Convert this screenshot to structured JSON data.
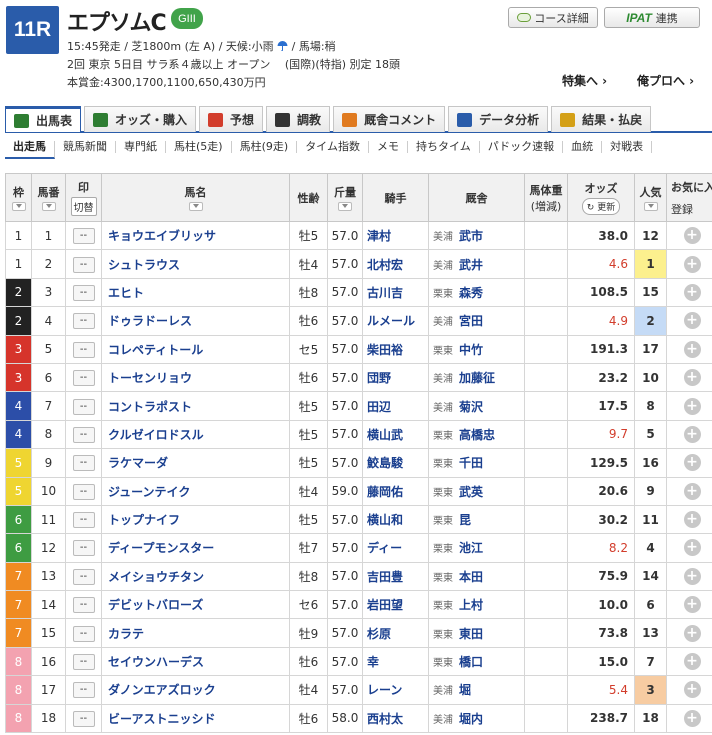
{
  "race": {
    "number": "11R",
    "name": "エプソムC",
    "grade": "GIII",
    "line1": "15:45発走 / 芝1800m (左 A) / 天候:小雨",
    "line1b": "/ 馬場:稍",
    "line2": "2回 東京 5日目 サラ系４歳以上 オープン　 (国際)(特指) 別定 18頭",
    "line3": "本賞金:4300,1700,1100,650,430万円"
  },
  "header_buttons": {
    "course": "コース詳細",
    "ipat_logo": "IPAT",
    "ipat": "連携"
  },
  "links": {
    "feature": "特集へ ›",
    "ore_pro": "俺プロへ ›"
  },
  "tabs": [
    {
      "label": "出馬表",
      "icon": "table-icon",
      "color": "#2e7d32"
    },
    {
      "label": "オッズ・購入",
      "icon": "ticket-icon",
      "color": "#2e7d32"
    },
    {
      "label": "予想",
      "icon": "target-icon",
      "color": "#d23d2c"
    },
    {
      "label": "調教",
      "icon": "stopwatch-icon",
      "color": "#333333"
    },
    {
      "label": "厩舎コメント",
      "icon": "stable-icon",
      "color": "#e07a1f"
    },
    {
      "label": "データ分析",
      "icon": "bar-chart-icon",
      "color": "#2a5caa"
    },
    {
      "label": "結果・払戻",
      "icon": "coins-icon",
      "color": "#d4a017"
    }
  ],
  "subnav": [
    "出走馬",
    "競馬新聞",
    "専門紙",
    "馬柱(5走)",
    "馬柱(9走)",
    "タイム指数",
    "メモ",
    "持ちタイム",
    "パドック速報",
    "血統",
    "対戦表"
  ],
  "columns": {
    "waku": "枠",
    "umaban": "馬番",
    "mark": "印",
    "mark_btn": "切替",
    "horse": "馬名",
    "sexage": "性齢",
    "weight": "斤量",
    "jockey": "騎手",
    "trainer": "厩舎",
    "bodyweight": "馬体重",
    "bodyweight_sub": "(増減)",
    "odds": "オッズ",
    "odds_btn": "更新",
    "pop": "人気",
    "fav": "お気に入",
    "fav_btn": "登録"
  },
  "horses": [
    {
      "waku": "1",
      "umaban": "1",
      "mark": "--",
      "name": "キョウエイブリッサ",
      "sexage": "牡5",
      "weight": "57.0",
      "jockey": "津村",
      "area": "美浦",
      "trainer": "武市",
      "odds": "38.0",
      "pop": "12"
    },
    {
      "waku": "1",
      "umaban": "2",
      "mark": "--",
      "name": "シュトラウス",
      "sexage": "牡4",
      "weight": "57.0",
      "jockey": "北村宏",
      "area": "美浦",
      "trainer": "武井",
      "odds": "4.6",
      "pop": "1"
    },
    {
      "waku": "2",
      "umaban": "3",
      "mark": "--",
      "name": "エヒト",
      "sexage": "牡8",
      "weight": "57.0",
      "jockey": "古川吉",
      "area": "栗東",
      "trainer": "森秀",
      "odds": "108.5",
      "pop": "15"
    },
    {
      "waku": "2",
      "umaban": "4",
      "mark": "--",
      "name": "ドゥラドーレス",
      "sexage": "牡6",
      "weight": "57.0",
      "jockey": "ルメール",
      "area": "美浦",
      "trainer": "宮田",
      "odds": "4.9",
      "pop": "2"
    },
    {
      "waku": "3",
      "umaban": "5",
      "mark": "--",
      "name": "コレペティトール",
      "sexage": "セ5",
      "weight": "57.0",
      "jockey": "柴田裕",
      "area": "栗東",
      "trainer": "中竹",
      "odds": "191.3",
      "pop": "17"
    },
    {
      "waku": "3",
      "umaban": "6",
      "mark": "--",
      "name": "トーセンリョウ",
      "sexage": "牡6",
      "weight": "57.0",
      "jockey": "団野",
      "area": "美浦",
      "trainer": "加藤征",
      "odds": "23.2",
      "pop": "10"
    },
    {
      "waku": "4",
      "umaban": "7",
      "mark": "--",
      "name": "コントラポスト",
      "sexage": "牡5",
      "weight": "57.0",
      "jockey": "田辺",
      "area": "美浦",
      "trainer": "菊沢",
      "odds": "17.5",
      "pop": "8"
    },
    {
      "waku": "4",
      "umaban": "8",
      "mark": "--",
      "name": "クルゼイロドスル",
      "sexage": "牡5",
      "weight": "57.0",
      "jockey": "横山武",
      "area": "栗東",
      "trainer": "高橋忠",
      "odds": "9.7",
      "pop": "5"
    },
    {
      "waku": "5",
      "umaban": "9",
      "mark": "--",
      "name": "ラケマーダ",
      "sexage": "牡5",
      "weight": "57.0",
      "jockey": "鮫島駿",
      "area": "栗東",
      "trainer": "千田",
      "odds": "129.5",
      "pop": "16"
    },
    {
      "waku": "5",
      "umaban": "10",
      "mark": "--",
      "name": "ジューンテイク",
      "sexage": "牡4",
      "weight": "59.0",
      "jockey": "藤岡佑",
      "area": "栗東",
      "trainer": "武英",
      "odds": "20.6",
      "pop": "9"
    },
    {
      "waku": "6",
      "umaban": "11",
      "mark": "--",
      "name": "トップナイフ",
      "sexage": "牡5",
      "weight": "57.0",
      "jockey": "横山和",
      "area": "栗東",
      "trainer": "昆",
      "odds": "30.2",
      "pop": "11"
    },
    {
      "waku": "6",
      "umaban": "12",
      "mark": "--",
      "name": "ディープモンスター",
      "sexage": "牡7",
      "weight": "57.0",
      "jockey": "ディー",
      "area": "栗東",
      "trainer": "池江",
      "odds": "8.2",
      "pop": "4"
    },
    {
      "waku": "7",
      "umaban": "13",
      "mark": "--",
      "name": "メイショウチタン",
      "sexage": "牡8",
      "weight": "57.0",
      "jockey": "吉田豊",
      "area": "栗東",
      "trainer": "本田",
      "odds": "75.9",
      "pop": "14"
    },
    {
      "waku": "7",
      "umaban": "14",
      "mark": "--",
      "name": "デビットバローズ",
      "sexage": "セ6",
      "weight": "57.0",
      "jockey": "岩田望",
      "area": "栗東",
      "trainer": "上村",
      "odds": "10.0",
      "pop": "6"
    },
    {
      "waku": "7",
      "umaban": "15",
      "mark": "--",
      "name": "カラテ",
      "sexage": "牡9",
      "weight": "57.0",
      "jockey": "杉原",
      "area": "栗東",
      "trainer": "東田",
      "odds": "73.8",
      "pop": "13"
    },
    {
      "waku": "8",
      "umaban": "16",
      "mark": "--",
      "name": "セイウンハーデス",
      "sexage": "牡6",
      "weight": "57.0",
      "jockey": "幸",
      "area": "栗東",
      "trainer": "橋口",
      "odds": "15.0",
      "pop": "7"
    },
    {
      "waku": "8",
      "umaban": "17",
      "mark": "--",
      "name": "ダノンエアズロック",
      "sexage": "牡4",
      "weight": "57.0",
      "jockey": "レーン",
      "area": "美浦",
      "trainer": "堀",
      "odds": "5.4",
      "pop": "3"
    },
    {
      "waku": "8",
      "umaban": "18",
      "mark": "--",
      "name": "ビーアストニッシド",
      "sexage": "牡6",
      "weight": "58.0",
      "jockey": "西村太",
      "area": "美浦",
      "trainer": "堀内",
      "odds": "238.7",
      "pop": "18"
    }
  ]
}
